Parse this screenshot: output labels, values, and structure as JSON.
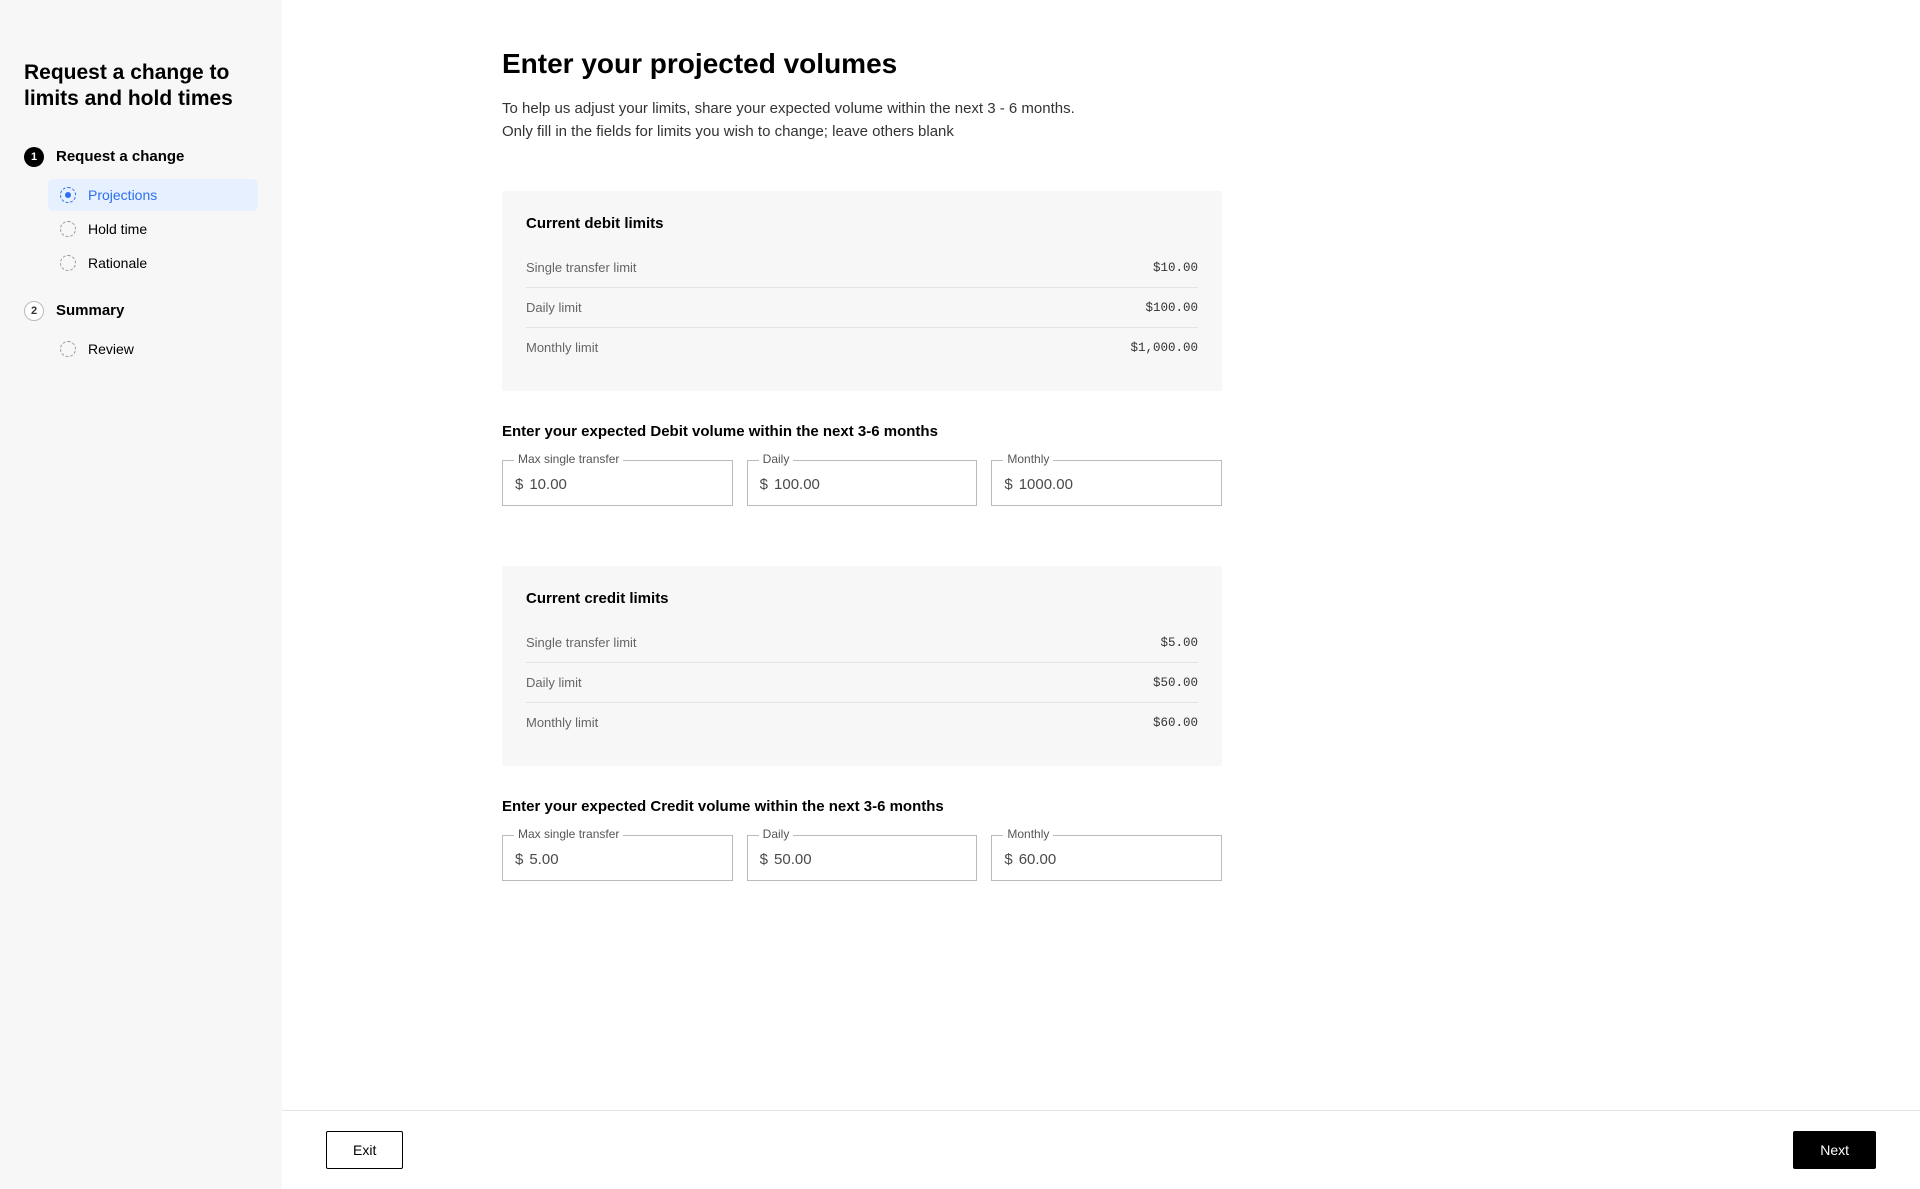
{
  "sidebar": {
    "title": "Request a change to limits and hold times",
    "steps": [
      {
        "number": "1",
        "title": "Request a change",
        "filled": true,
        "items": [
          {
            "label": "Projections",
            "active": true
          },
          {
            "label": "Hold time",
            "active": false
          },
          {
            "label": "Rationale",
            "active": false
          }
        ]
      },
      {
        "number": "2",
        "title": "Summary",
        "filled": false,
        "items": [
          {
            "label": "Review",
            "active": false
          }
        ]
      }
    ]
  },
  "main": {
    "heading": "Enter your projected volumes",
    "description_line1": "To help us adjust your limits, share your expected volume within the next 3 - 6 months.",
    "description_line2": "Only fill in the fields for limits you wish to change; leave others blank",
    "debit_card": {
      "title": "Current debit limits",
      "rows": {
        "single": {
          "label": "Single transfer limit",
          "value": "$10.00"
        },
        "daily": {
          "label": "Daily limit",
          "value": "$100.00"
        },
        "monthly": {
          "label": "Monthly limit",
          "value": "$1,000.00"
        }
      }
    },
    "debit_inputs": {
      "section_label": "Enter your expected Debit volume within the next 3-6 months",
      "max_single": {
        "label": "Max single transfer",
        "prefix": "$",
        "value": "10.00"
      },
      "daily": {
        "label": "Daily",
        "prefix": "$",
        "value": "100.00"
      },
      "monthly": {
        "label": "Monthly",
        "prefix": "$",
        "value": "1000.00"
      }
    },
    "credit_card": {
      "title": "Current credit limits",
      "rows": {
        "single": {
          "label": "Single transfer limit",
          "value": "$5.00"
        },
        "daily": {
          "label": "Daily limit",
          "value": "$50.00"
        },
        "monthly": {
          "label": "Monthly limit",
          "value": "$60.00"
        }
      }
    },
    "credit_inputs": {
      "section_label": "Enter your expected Credit volume within the next 3-6 months",
      "max_single": {
        "label": "Max single transfer",
        "prefix": "$",
        "value": "5.00"
      },
      "daily": {
        "label": "Daily",
        "prefix": "$",
        "value": "50.00"
      },
      "monthly": {
        "label": "Monthly",
        "prefix": "$",
        "value": "60.00"
      }
    }
  },
  "footer": {
    "exit_label": "Exit",
    "next_label": "Next"
  }
}
